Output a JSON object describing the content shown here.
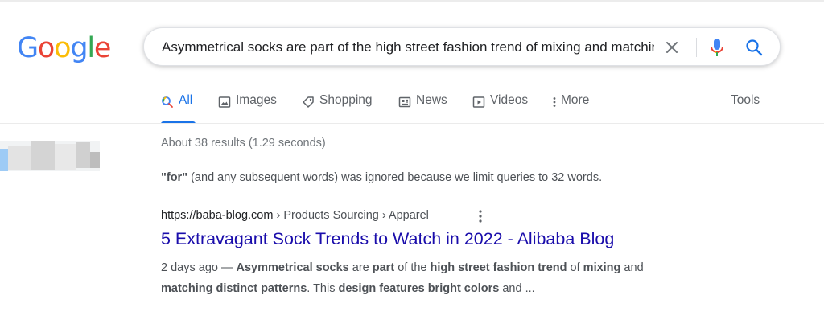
{
  "logo": {
    "letters": [
      {
        "ch": "G",
        "color": "#4285F4"
      },
      {
        "ch": "o",
        "color": "#EA4335"
      },
      {
        "ch": "o",
        "color": "#FBBC05"
      },
      {
        "ch": "g",
        "color": "#4285F4"
      },
      {
        "ch": "l",
        "color": "#34A853"
      },
      {
        "ch": "e",
        "color": "#EA4335"
      }
    ]
  },
  "search": {
    "query": "Asymmetrical socks are part of the high street fashion trend of mixing and matching distinct patterns"
  },
  "tabs": [
    {
      "label": "All",
      "icon": "search-icon",
      "active": true
    },
    {
      "label": "Images",
      "icon": "image-icon"
    },
    {
      "label": "Shopping",
      "icon": "tag-icon"
    },
    {
      "label": "News",
      "icon": "newspaper-icon"
    },
    {
      "label": "Videos",
      "icon": "play-icon"
    },
    {
      "label": "More",
      "icon": "more-vert-icon"
    }
  ],
  "tools_label": "Tools",
  "result_stats": "About 38 results (1.29 seconds)",
  "ignored_notice": {
    "word": "\"for\"",
    "text": " (and any subsequent words) was ignored because we limit queries to 32 words."
  },
  "result": {
    "url": "https://baba-blog.com",
    "breadcrumbs": " › Products Sourcing › Apparel",
    "title": "5 Extravagant Sock Trends to Watch in 2022 - Alibaba Blog",
    "snippet": [
      {
        "t": "2 days ago — ",
        "b": false
      },
      {
        "t": "Asymmetrical socks",
        "b": true
      },
      {
        "t": " are ",
        "b": false
      },
      {
        "t": "part",
        "b": true
      },
      {
        "t": " of the ",
        "b": false
      },
      {
        "t": "high street fashion trend",
        "b": true
      },
      {
        "t": " of ",
        "b": false
      },
      {
        "t": "mixing",
        "b": true
      },
      {
        "t": " and ",
        "b": false
      },
      {
        "t": "matching distinct patterns",
        "b": true
      },
      {
        "t": ". This ",
        "b": false
      },
      {
        "t": "design features bright colors",
        "b": true
      },
      {
        "t": " and ...",
        "b": false
      }
    ]
  },
  "colors": {
    "accent": "#1a73e8",
    "link": "#1a0dab",
    "muted": "#70757a"
  }
}
